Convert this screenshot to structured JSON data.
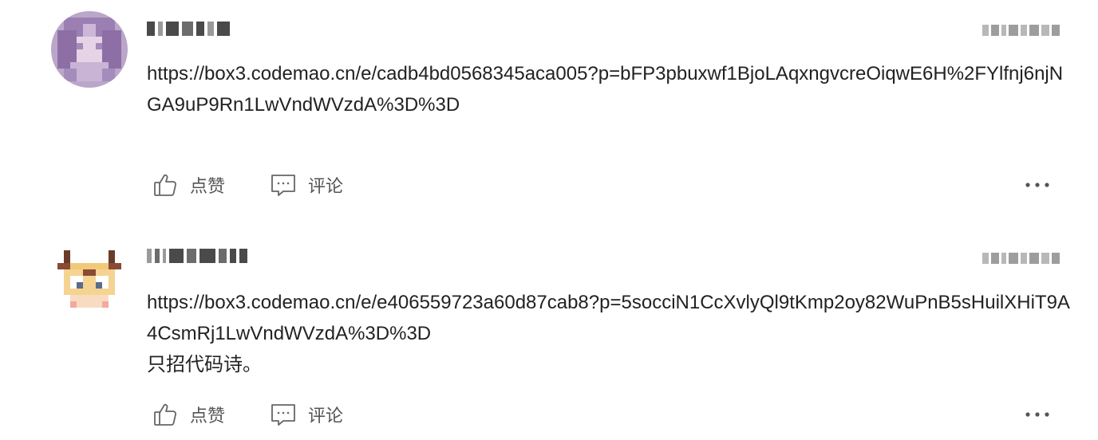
{
  "comments": [
    {
      "content": "https://box3.codemao.cn/e/cadb4bd0568345aca005?p=bFP3pbuxwf1BjoLAqxngvcreOiqwE6H%2FYlfnj6njNGA9uP9Rn1LwVndWVzdA%3D%3D",
      "like_label": "点赞",
      "comment_label": "评论",
      "avatar_icon": "avatar-purple-character",
      "like_icon": "thumbs-up-icon",
      "comment_icon": "comment-bubble-icon",
      "more_icon": "more-dots-icon"
    },
    {
      "content": "https://box3.codemao.cn/e/e406559723a60d87cab8?p=5socciN1CcXvlyQl9tKmp2oy82WuPnB5sHuilXHiT9A4CsmRj1LwVndWVzdA%3D%3D\n只招代码诗。",
      "like_label": "点赞",
      "comment_label": "评论",
      "avatar_icon": "avatar-pixel-character",
      "like_icon": "thumbs-up-icon",
      "comment_icon": "comment-bubble-icon",
      "more_icon": "more-dots-icon"
    }
  ],
  "colors": {
    "text": "#222222",
    "action_text": "#555555",
    "icon_stroke": "#666666"
  }
}
